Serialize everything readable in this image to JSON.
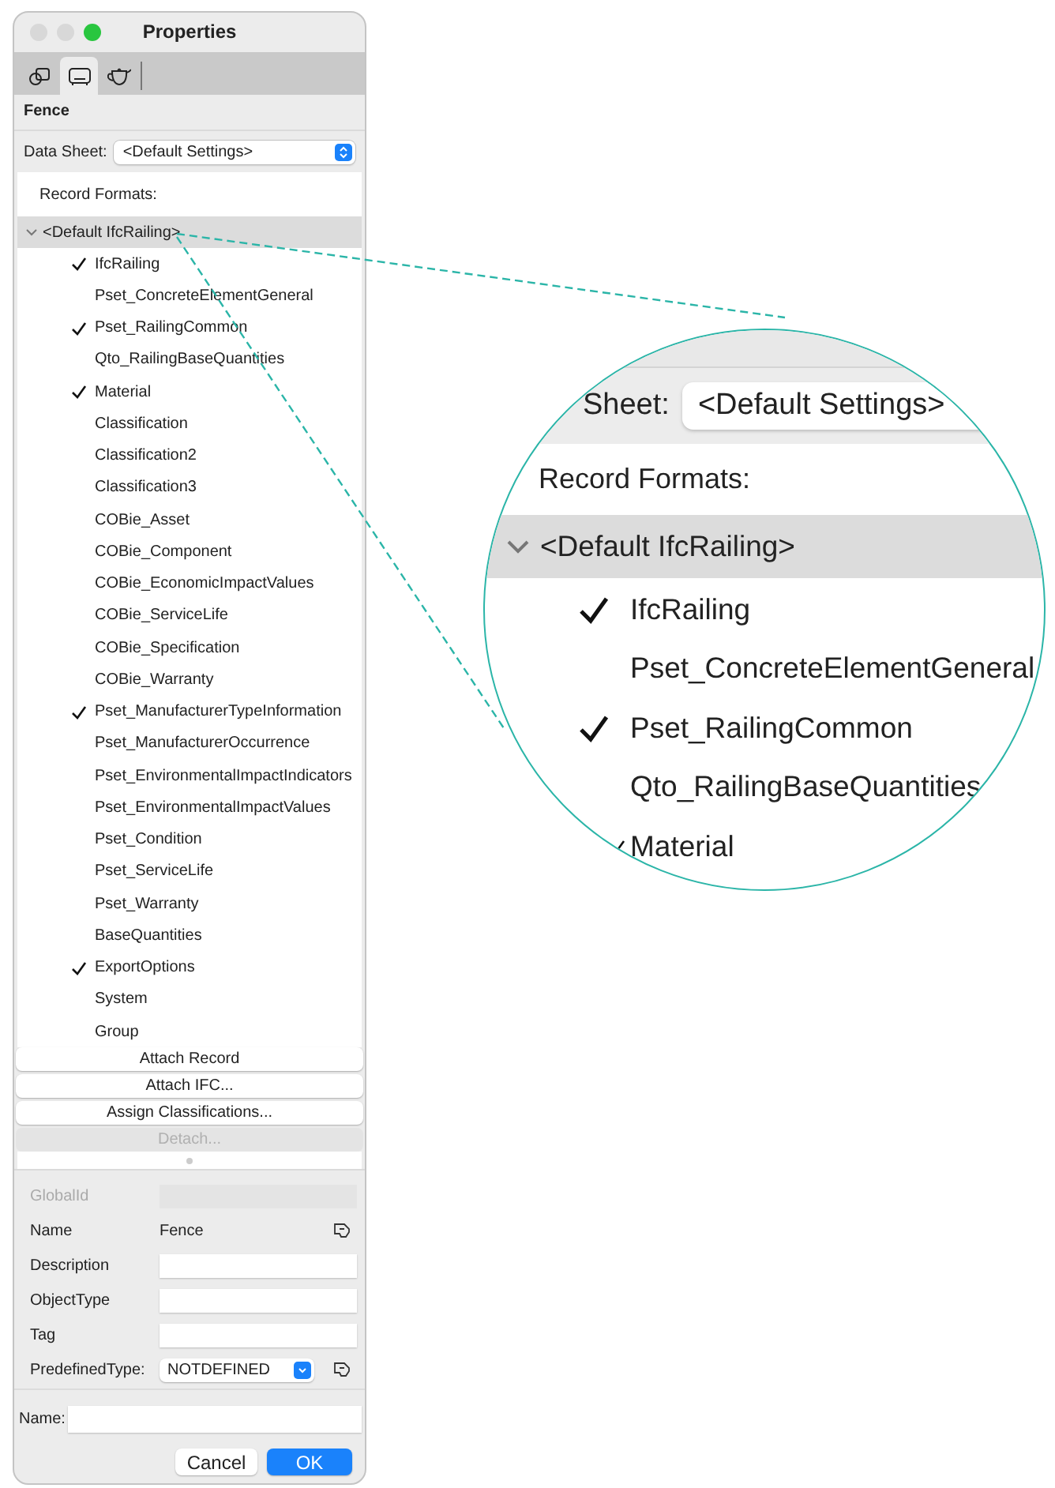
{
  "window": {
    "title": "Properties"
  },
  "tabs": [
    {
      "kind": "shape",
      "selected": false
    },
    {
      "kind": "data",
      "selected": true
    },
    {
      "kind": "render",
      "selected": false
    }
  ],
  "object_name": "Fence",
  "data_sheet": {
    "label": "Data Sheet:",
    "value": "<Default Settings>"
  },
  "record_formats": {
    "label": "Record Formats:",
    "group": {
      "label": "<Default IfcRailing>",
      "expanded": true,
      "selected": true,
      "children": [
        {
          "label": "IfcRailing",
          "checked": true
        },
        {
          "label": "Pset_ConcreteElementGeneral",
          "checked": false
        },
        {
          "label": "Pset_RailingCommon",
          "checked": true
        },
        {
          "label": "Qto_RailingBaseQuantities",
          "checked": false
        },
        {
          "label": "Material",
          "checked": true
        },
        {
          "label": "Classification",
          "checked": false
        },
        {
          "label": "Classification2",
          "checked": false
        },
        {
          "label": "Classification3",
          "checked": false
        },
        {
          "label": "COBie_Asset",
          "checked": false
        },
        {
          "label": "COBie_Component",
          "checked": false
        },
        {
          "label": "COBie_EconomicImpactValues",
          "checked": false
        },
        {
          "label": "COBie_ServiceLife",
          "checked": false
        },
        {
          "label": "COBie_Specification",
          "checked": false
        },
        {
          "label": "COBie_Warranty",
          "checked": false
        },
        {
          "label": "Pset_ManufacturerTypeInformation",
          "checked": true
        },
        {
          "label": "Pset_ManufacturerOccurrence",
          "checked": false
        },
        {
          "label": "Pset_EnvironmentalImpactIndicators",
          "checked": false
        },
        {
          "label": "Pset_EnvironmentalImpactValues",
          "checked": false
        },
        {
          "label": "Pset_Condition",
          "checked": false
        },
        {
          "label": "Pset_ServiceLife",
          "checked": false
        },
        {
          "label": "Pset_Warranty",
          "checked": false
        },
        {
          "label": "BaseQuantities",
          "checked": false
        },
        {
          "label": "ExportOptions",
          "checked": true
        },
        {
          "label": "System",
          "checked": false
        },
        {
          "label": "Group",
          "checked": false
        }
      ]
    }
  },
  "buttons": [
    {
      "label": "Attach Record",
      "disabled": false
    },
    {
      "label": "Attach IFC...",
      "disabled": false
    },
    {
      "label": "Assign Classifications...",
      "disabled": false
    },
    {
      "label": "Detach...",
      "disabled": true
    }
  ],
  "fields": [
    {
      "label": "GlobalId",
      "kind": "text",
      "disabled": true,
      "picker": false
    },
    {
      "label": "Name",
      "kind": "static",
      "value": "Fence",
      "disabled": false,
      "picker": true
    },
    {
      "label": "Description",
      "kind": "text",
      "disabled": false,
      "picker": false
    },
    {
      "label": "ObjectType",
      "kind": "text",
      "disabled": false,
      "picker": false
    },
    {
      "label": "Tag",
      "kind": "text",
      "disabled": false,
      "picker": false
    },
    {
      "label": "PredefinedType:",
      "kind": "select",
      "value": "NOTDEFINED",
      "disabled": false,
      "picker": true
    }
  ],
  "name_field": {
    "label": "Name:"
  },
  "dialog_buttons": [
    {
      "label": "Cancel",
      "default": false
    },
    {
      "label": "OK",
      "default": true
    }
  ],
  "magnifier": {
    "data_sheet_label": "Sheet:",
    "data_sheet_value": "<Default Settings>",
    "record_formats_label": "Record Formats:",
    "group_label": "<Default IfcRailing>",
    "expanded": true,
    "items": [
      {
        "label": "IfcRailing",
        "checked": true
      },
      {
        "label": "Pset_ConcreteElementGeneral",
        "checked": false
      },
      {
        "label": "Pset_RailingCommon",
        "checked": true
      },
      {
        "label": "Qto_RailingBaseQuantities",
        "checked": false
      },
      {
        "label": "Material",
        "checked": true
      }
    ]
  }
}
